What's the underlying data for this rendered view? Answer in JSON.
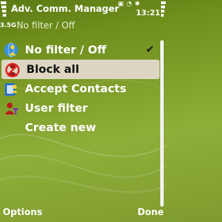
{
  "header": {
    "title": "Adv. Comm. Manager",
    "subtitle": "No filter / Off",
    "network": "3.5G",
    "time": "13:21",
    "status_icons": [
      "profile-icon",
      "alarm-icon",
      "bluetooth-icon"
    ]
  },
  "list": {
    "items": [
      {
        "label": "No filter / Off",
        "icon": "globe-person-icon",
        "checked": true,
        "selected": false
      },
      {
        "label": "Block all",
        "icon": "blocked-person-icon",
        "checked": false,
        "selected": true
      },
      {
        "label": "Accept Contacts",
        "icon": "contacts-icon",
        "checked": false,
        "selected": false
      },
      {
        "label": "User filter",
        "icon": "user-filter-icon",
        "checked": false,
        "selected": false
      },
      {
        "label": "Create new",
        "icon": "",
        "checked": false,
        "selected": false
      }
    ]
  },
  "softkeys": {
    "left": "Options",
    "right": "Done"
  },
  "colors": {
    "background": "#7f9e2a",
    "highlight": "#dcd6c2",
    "text": "#ffffff"
  }
}
